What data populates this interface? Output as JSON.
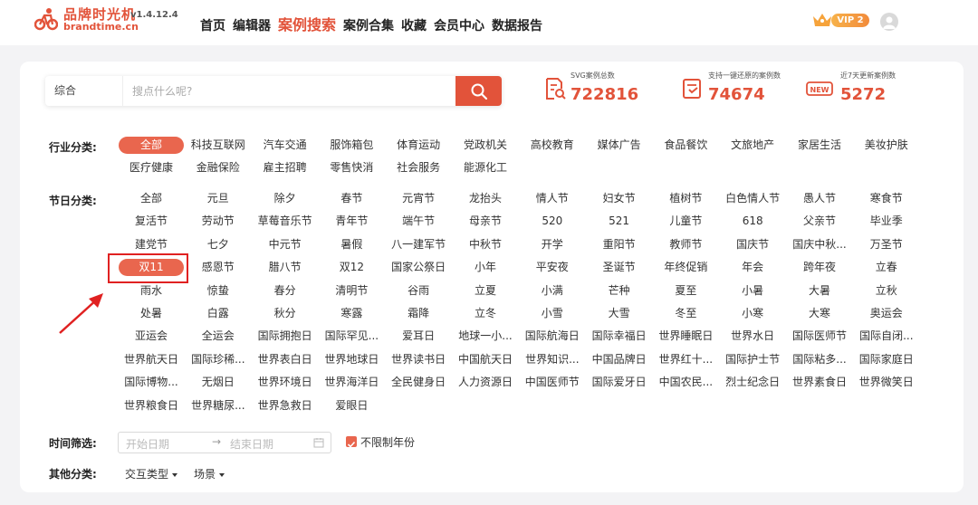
{
  "header": {
    "logo_title": "品牌时光机",
    "logo_sub": "brandtime.cn",
    "version": "v1.4.12.4",
    "nav": [
      "首页",
      "编辑器",
      "案例搜索",
      "案例合集",
      "收藏",
      "会员中心",
      "数据报告"
    ],
    "nav_active": "案例搜索",
    "vip_label": "VIP 2"
  },
  "search": {
    "type": "综合",
    "placeholder": "搜点什么呢?"
  },
  "stats": [
    {
      "label": "SVG案例总数",
      "value": "722816",
      "icon": "document-search-icon"
    },
    {
      "label": "支持一键还原的案例数",
      "value": "74674",
      "icon": "restore-icon"
    },
    {
      "label": "近7天更新案例数",
      "value": "5272",
      "icon": "new-badge-icon",
      "icon_text": "NEW"
    }
  ],
  "industry": {
    "label": "行业分类:",
    "items": [
      "全部",
      "科技互联网",
      "汽车交通",
      "服饰箱包",
      "体育运动",
      "党政机关",
      "高校教育",
      "媒体广告",
      "食品餐饮",
      "文旅地产",
      "家居生活",
      "美妆护肤",
      "医疗健康",
      "金融保险",
      "雇主招聘",
      "零售快消",
      "社会服务",
      "能源化工"
    ],
    "selected": "全部"
  },
  "festival": {
    "label": "节日分类:",
    "items": [
      "全部",
      "元旦",
      "除夕",
      "春节",
      "元宵节",
      "龙抬头",
      "情人节",
      "妇女节",
      "植树节",
      "白色情人节",
      "愚人节",
      "寒食节",
      "复活节",
      "劳动节",
      "草莓音乐节",
      "青年节",
      "端午节",
      "母亲节",
      "520",
      "521",
      "儿童节",
      "618",
      "父亲节",
      "毕业季",
      "建党节",
      "七夕",
      "中元节",
      "暑假",
      "八一建军节",
      "中秋节",
      "开学",
      "重阳节",
      "教师节",
      "国庆节",
      "国庆中秋...",
      "万圣节",
      "双11",
      "感恩节",
      "腊八节",
      "双12",
      "国家公祭日",
      "小年",
      "平安夜",
      "圣诞节",
      "年终促销",
      "年会",
      "跨年夜",
      "立春",
      "雨水",
      "惊蛰",
      "春分",
      "清明节",
      "谷雨",
      "立夏",
      "小满",
      "芒种",
      "夏至",
      "小暑",
      "大暑",
      "立秋",
      "处暑",
      "白露",
      "秋分",
      "寒露",
      "霜降",
      "立冬",
      "小雪",
      "大雪",
      "冬至",
      "小寒",
      "大寒",
      "奥运会",
      "亚运会",
      "全运会",
      "国际拥抱日",
      "国际罕见...",
      "爱耳日",
      "地球一小...",
      "国际航海日",
      "国际幸福日",
      "世界睡眠日",
      "世界水日",
      "国际医师节",
      "国际自闭...",
      "世界航天日",
      "国际珍稀...",
      "世界表白日",
      "世界地球日",
      "世界读书日",
      "中国航天日",
      "世界知识...",
      "中国品牌日",
      "世界红十...",
      "国际护士节",
      "国际粘多...",
      "国际家庭日",
      "国际博物...",
      "无烟日",
      "世界环境日",
      "世界海洋日",
      "全民健身日",
      "人力资源日",
      "中国医师节",
      "国际爱牙日",
      "中国农民...",
      "烈士纪念日",
      "世界素食日",
      "世界微笑日",
      "世界粮食日",
      "世界糖尿...",
      "世界急救日",
      "爱眼日"
    ],
    "selected": "双11"
  },
  "time_filter": {
    "label": "时间筛选:",
    "start_placeholder": "开始日期",
    "end_placeholder": "结束日期",
    "arrow": "→",
    "unlimited_year_label": "不限制年份",
    "unlimited_year_checked": true
  },
  "other": {
    "label": "其他分类:",
    "dropdowns": [
      "交互类型",
      "场景"
    ]
  },
  "colors": {
    "accent": "#e2533a",
    "tag_selected": "#e9664e",
    "annotation_red": "#e02121"
  }
}
